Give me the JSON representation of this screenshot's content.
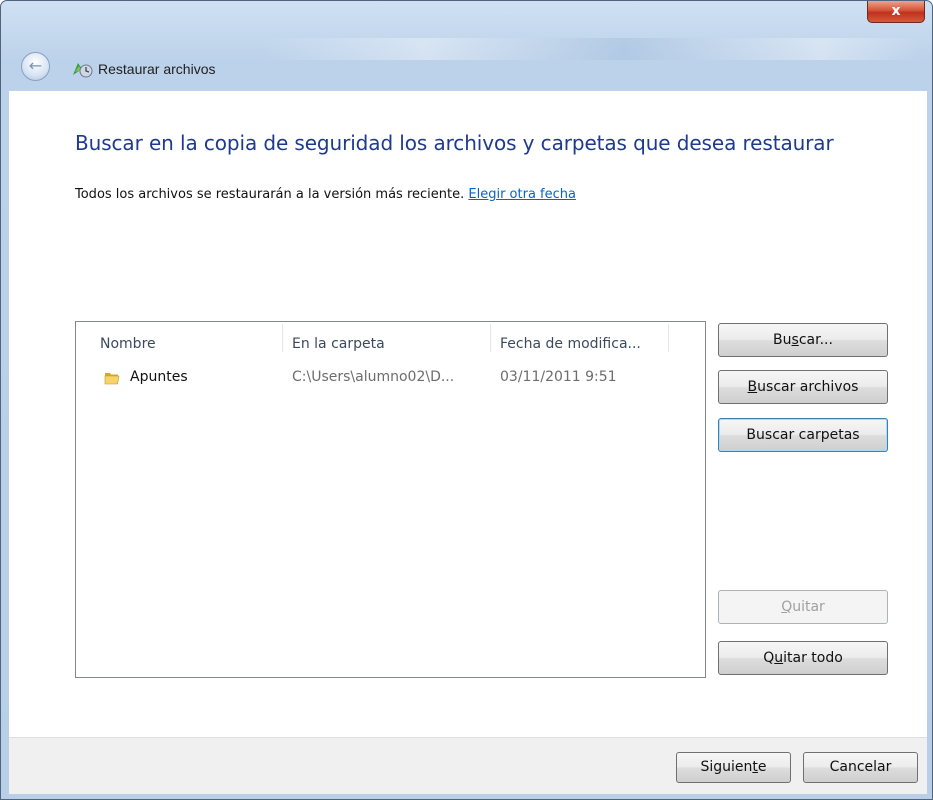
{
  "window": {
    "title": "Restaurar archivos",
    "close_label": "x"
  },
  "main": {
    "heading": "Buscar en la copia de seguridad los archivos y carpetas que desea restaurar",
    "info_text": "Todos los archivos se restaurarán a la versión más reciente.",
    "info_link": "Elegir otra fecha"
  },
  "table": {
    "columns": [
      "Nombre",
      "En la carpeta",
      "Fecha de modifica..."
    ],
    "rows": [
      {
        "name": "Apuntes",
        "folder": "C:\\Users\\alumno02\\D...",
        "date": "03/11/2011 9:51",
        "icon": "folder-icon"
      }
    ]
  },
  "side_buttons": {
    "search": {
      "pre": "Bu",
      "key": "s",
      "post": "car..."
    },
    "search_files": {
      "pre": "",
      "key": "B",
      "post": "uscar archivos"
    },
    "search_folders": {
      "label": "Buscar carpetas"
    },
    "remove": {
      "pre": "",
      "key": "Q",
      "post": "uitar",
      "disabled": true
    },
    "remove_all": {
      "pre": "Q",
      "key": "u",
      "post": "itar todo"
    }
  },
  "footer": {
    "next": {
      "pre": "Siguien",
      "key": "t",
      "post": "e"
    },
    "cancel": "Cancelar"
  },
  "colors": {
    "heading": "#1e3a8e",
    "link": "#0066cc",
    "close_button": "#c0311c",
    "footer_bg": "#f0f0f0"
  }
}
